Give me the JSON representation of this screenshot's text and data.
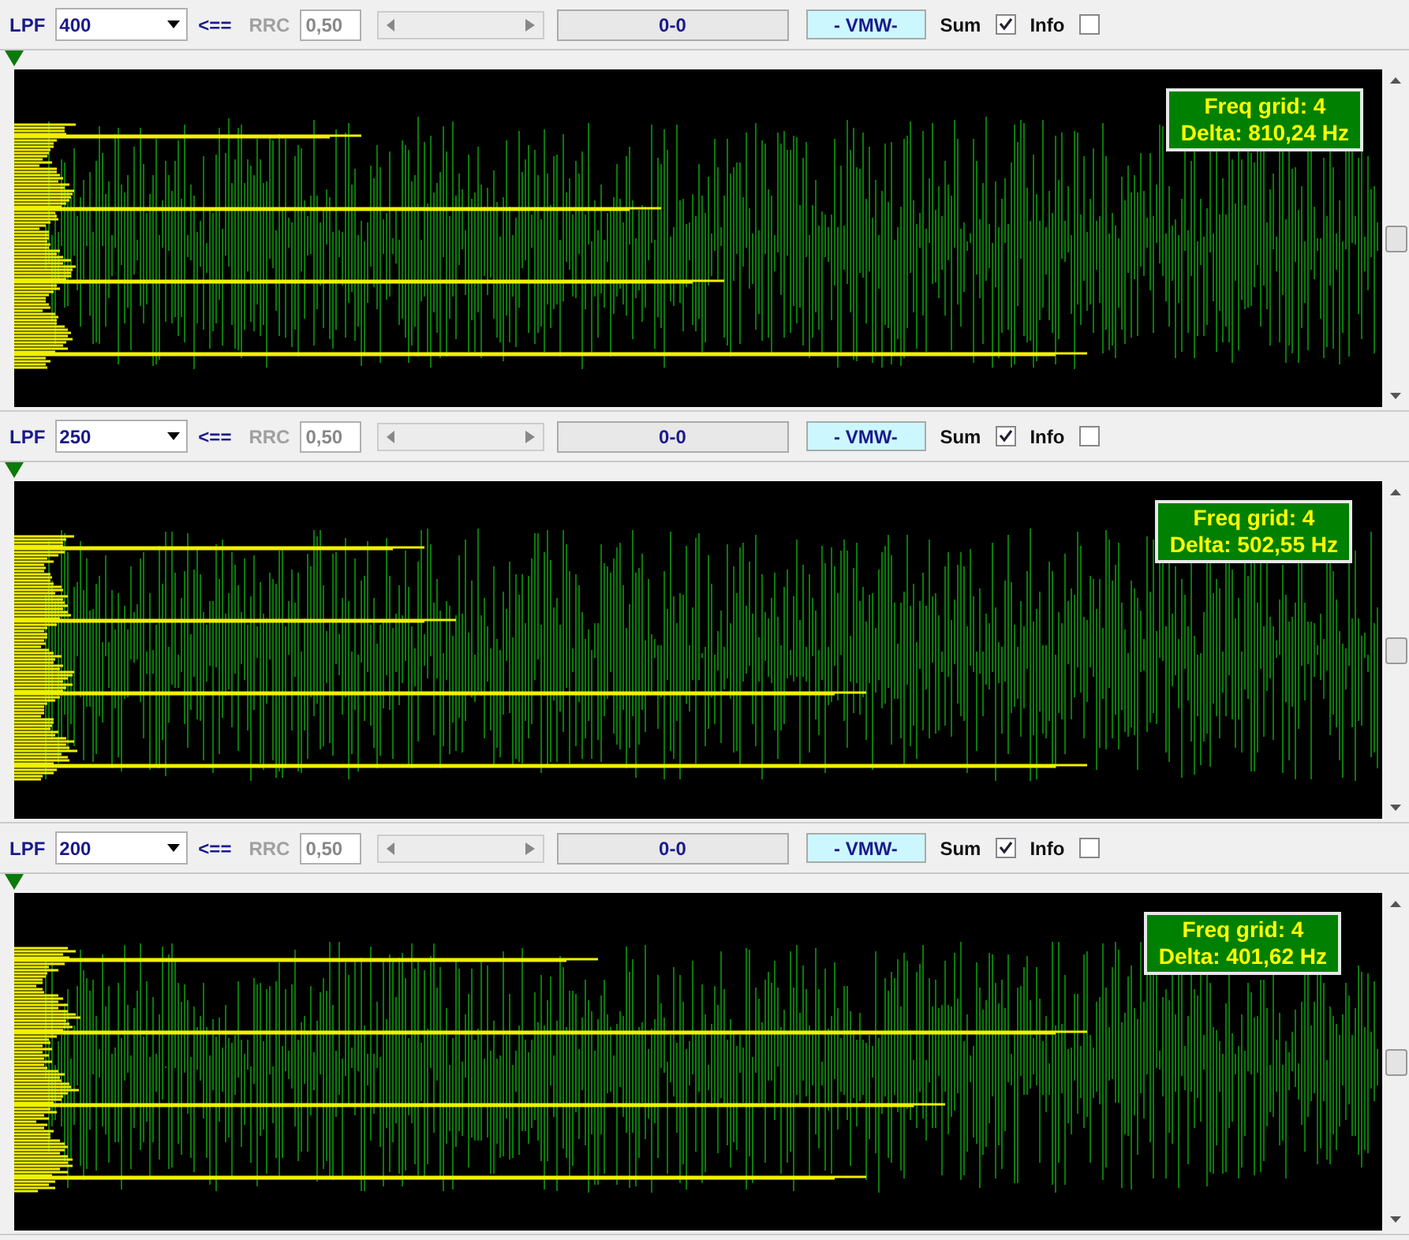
{
  "panels": [
    {
      "lpf_label": "LPF",
      "lpf_value": "400",
      "arrow": "<==",
      "rrc_label": "RRC",
      "rrc_disabled": true,
      "rrc_value": "0,50",
      "status": "0-0",
      "mode": "- VMW-",
      "sum_label": "Sum",
      "sum_checked": true,
      "info_label": "Info",
      "info_checked": false,
      "freq_grid": "Freq grid: 4",
      "delta": "Delta: 810,24 Hz"
    },
    {
      "lpf_label": "LPF",
      "lpf_value": "250",
      "arrow": "<==",
      "rrc_label": "RRC",
      "rrc_disabled": true,
      "rrc_value": "0,50",
      "status": "0-0",
      "mode": "- VMW-",
      "sum_label": "Sum",
      "sum_checked": true,
      "info_label": "Info",
      "info_checked": false,
      "freq_grid": "Freq grid: 4",
      "delta": "Delta: 502,55 Hz"
    },
    {
      "lpf_label": "LPF",
      "lpf_value": "200",
      "arrow": "<==",
      "rrc_label": "RRC",
      "rrc_disabled": true,
      "rrc_value": "0,50",
      "status": "0-0",
      "mode": "- VMW-",
      "sum_label": "Sum",
      "sum_checked": true,
      "info_label": "Info",
      "info_checked": false,
      "freq_grid": "Freq grid: 4",
      "delta": "Delta: 401,62 Hz"
    }
  ]
}
